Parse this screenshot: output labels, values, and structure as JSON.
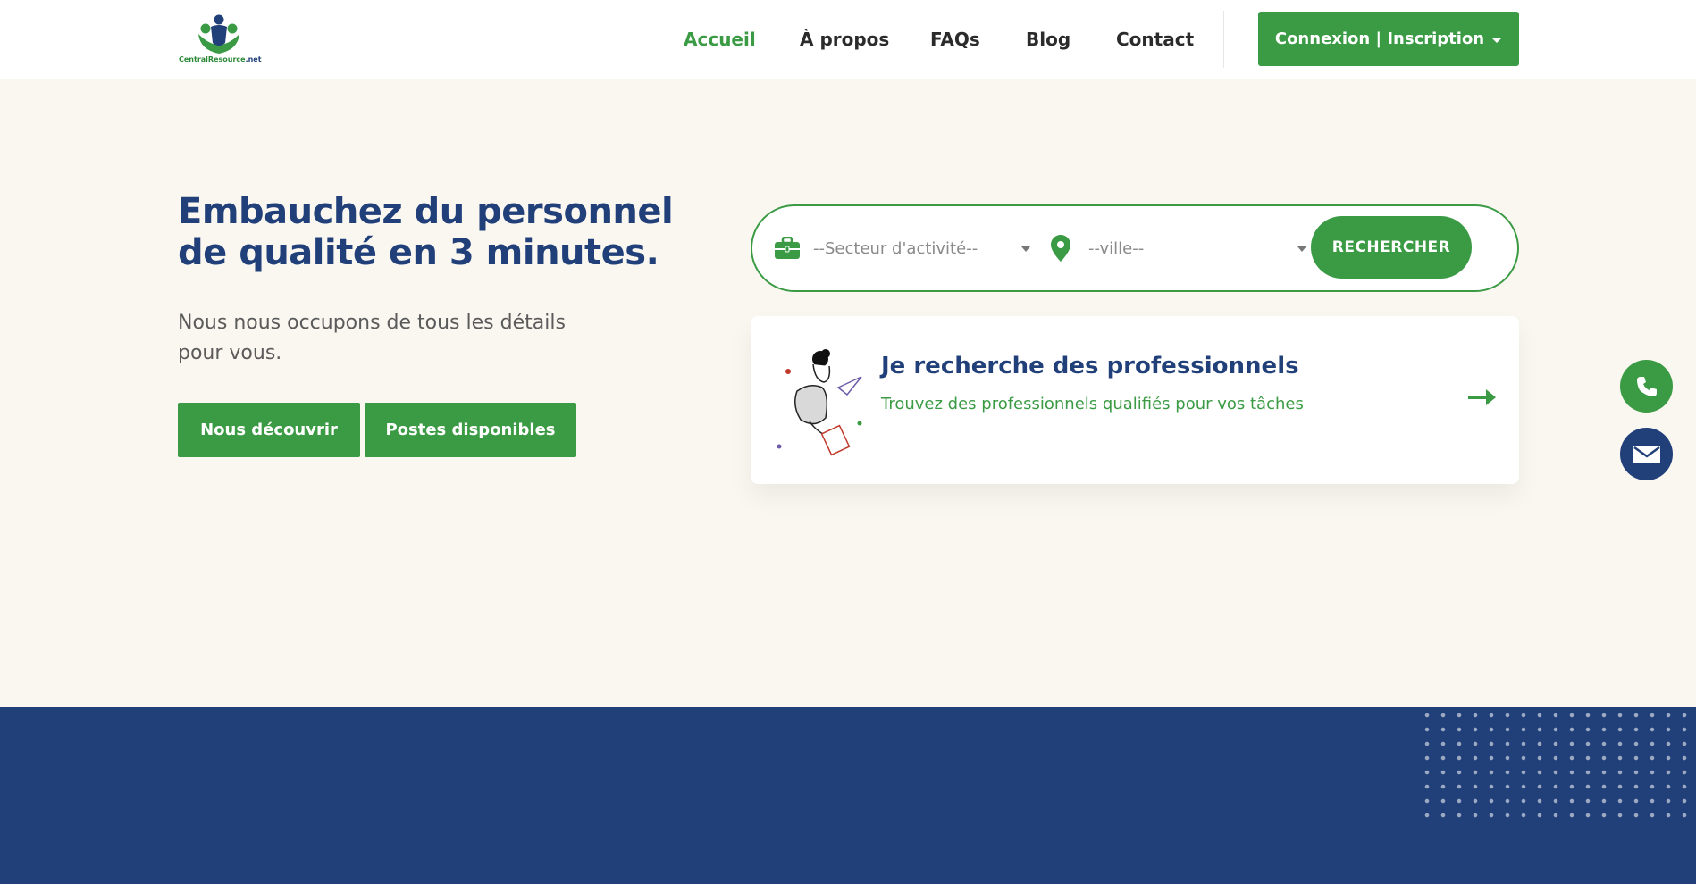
{
  "header": {
    "logo": {
      "brand": "CentralResource",
      "tld": ".net"
    },
    "nav": [
      {
        "label": "Accueil",
        "active": true
      },
      {
        "label": "À propos",
        "active": false
      },
      {
        "label": "FAQs",
        "active": false
      },
      {
        "label": "Blog",
        "active": false
      },
      {
        "label": "Contact",
        "active": false
      }
    ],
    "login_label": "Connexion | Inscription"
  },
  "hero": {
    "title_line1": "Embauchez du personnel",
    "title_line2": "de qualité en 3 minutes.",
    "subtitle_line1": "Nous nous occupons de tous les détails",
    "subtitle_line2": "pour vous.",
    "btn_discover": "Nous découvrir",
    "btn_positions": "Postes disponibles"
  },
  "search": {
    "sector_placeholder": "--Secteur d'activité--",
    "city_placeholder": "--ville--",
    "button_label": "RECHERCHER"
  },
  "card": {
    "title": "Je recherche des professionnels",
    "subtitle": "Trouvez des professionnels qualifiés pour vos tâches"
  },
  "icons": {
    "sector": "briefcase-icon",
    "city": "map-pin-icon",
    "card_arrow": "arrow-right-icon",
    "fab_phone": "phone-icon",
    "fab_mail": "envelope-icon"
  },
  "colors": {
    "brand_green": "#3b9b44",
    "brand_navy": "#21407a",
    "page_bg": "#faf7f1"
  }
}
